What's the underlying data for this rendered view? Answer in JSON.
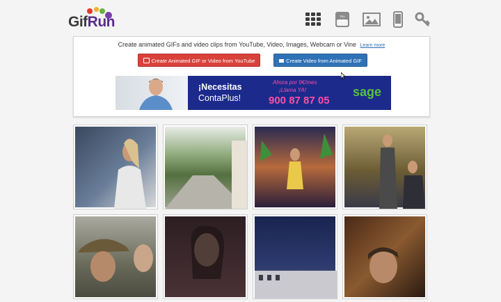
{
  "brand": {
    "logo_prefix": "Gif",
    "logo_suffix": "Run",
    "colors": {
      "dark": "#3a3a3a",
      "purple": "#5b2d8a",
      "red": "#e23b2e",
      "yellow": "#f1b31c",
      "green": "#68b23b",
      "blue": "#2d7bc0"
    }
  },
  "nav": {
    "icons": [
      "grid-icon",
      "youtube-icon",
      "image-icon",
      "mobile-icon",
      "key-icon"
    ],
    "youtube_label": "You Tube"
  },
  "create": {
    "intro": "Create animated GIFs and video clips from YouTube, Video, Images, Webcam or Vine",
    "learn_more": "Learn more",
    "btn_youtube": "Create Animated GIF or Video from YouTube",
    "btn_video": "Create Video from Animated GIF"
  },
  "ad": {
    "headline1": "¡Necesitas",
    "headline2": "ContaPlus!",
    "offer1": "Ahora por 9€/mes",
    "offer2": "¡Llama YA!",
    "phone": "900 87 87 05",
    "brand": "sage"
  },
  "gallery": {
    "items": [
      {
        "subject": "singer-on-stage",
        "color": "#4b5a72"
      },
      {
        "subject": "outdoor-path",
        "color": "#7f9b6a"
      },
      {
        "subject": "stage-dancer",
        "color": "#b76a3c"
      },
      {
        "subject": "talk-show-set",
        "color": "#7a6a3e"
      },
      {
        "subject": "soldier-hat",
        "color": "#6a6a5a"
      },
      {
        "subject": "woman-portrait",
        "color": "#3a2a2c"
      },
      {
        "subject": "night-skyline",
        "color": "#1f2a52"
      },
      {
        "subject": "man-crowd",
        "color": "#5a3a22"
      }
    ]
  }
}
